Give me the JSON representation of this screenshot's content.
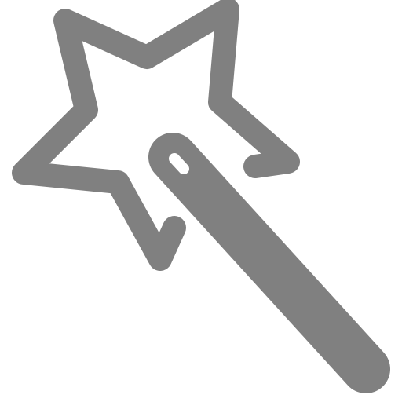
{
  "icon": {
    "name": "magic-wand-icon",
    "color": "#808080",
    "background": "#ffffff"
  }
}
